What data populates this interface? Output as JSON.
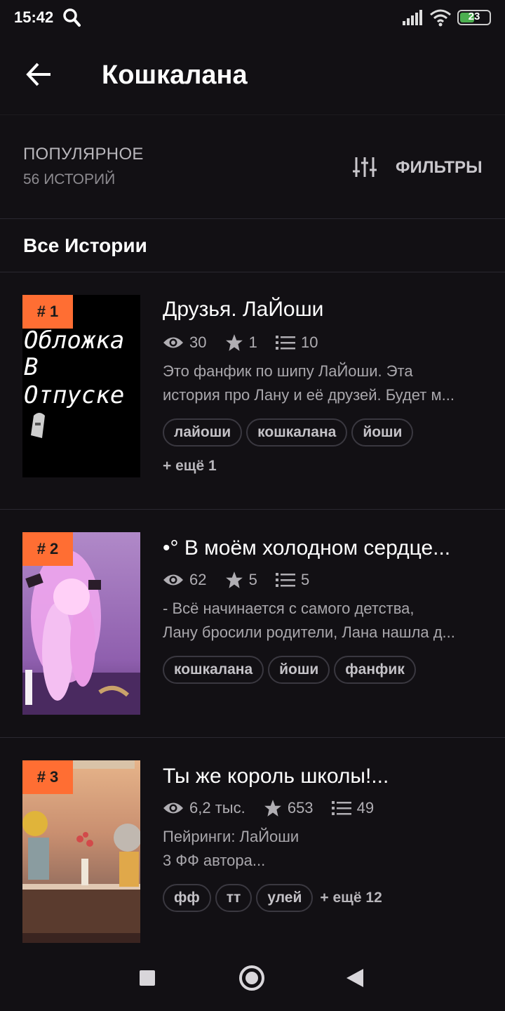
{
  "status_bar": {
    "time": "15:42",
    "battery": "23"
  },
  "header": {
    "title": "Кошкалана"
  },
  "sort": {
    "title": "ПОПУЛЯРНОЕ",
    "count": "56 ИСТОРИЙ",
    "filters_label": "ФИЛЬТРЫ"
  },
  "section": {
    "title": "Все Истории"
  },
  "stories": [
    {
      "rank": "# 1",
      "title": "Друзья. ЛаЙоши",
      "views": "30",
      "stars": "1",
      "parts": "10",
      "description": [
        "Это фанфик по шипу ЛаЙоши. Эта",
        "история про Лану и её друзей. Будет м..."
      ],
      "tags": [
        "лайоши",
        "кошкалана",
        "йоши"
      ],
      "more": "+ ещё 1",
      "cover_text": [
        "Обложка",
        "В",
        "Отпуске"
      ]
    },
    {
      "rank": "# 2",
      "title": "•° В моём холодном сердце...",
      "views": "62",
      "stars": "5",
      "parts": "5",
      "description": [
        "- Всё начинается с самого детства,",
        "Лану бросили родители, Лана нашла д..."
      ],
      "tags": [
        "кошкалана",
        "йоши",
        "фанфик"
      ]
    },
    {
      "rank": "# 3",
      "title": "Ты же король школы!...",
      "views": "6,2 тыс.",
      "stars": "653",
      "parts": "49",
      "description": [
        "Пейринги: ЛаЙоши",
        "3 ФФ автора..."
      ],
      "tags": [
        "фф",
        "тт",
        "улей"
      ],
      "more": "+ ещё 12"
    }
  ],
  "colors": {
    "accent": "#ff6e33",
    "background": "#121014"
  },
  "icons": [
    "search-icon",
    "signal-icon",
    "wifi-icon",
    "battery-icon",
    "back-arrow-icon",
    "filter-sliders-icon",
    "eye-icon",
    "star-icon",
    "list-icon",
    "recent-apps-icon",
    "home-icon",
    "back-icon"
  ]
}
